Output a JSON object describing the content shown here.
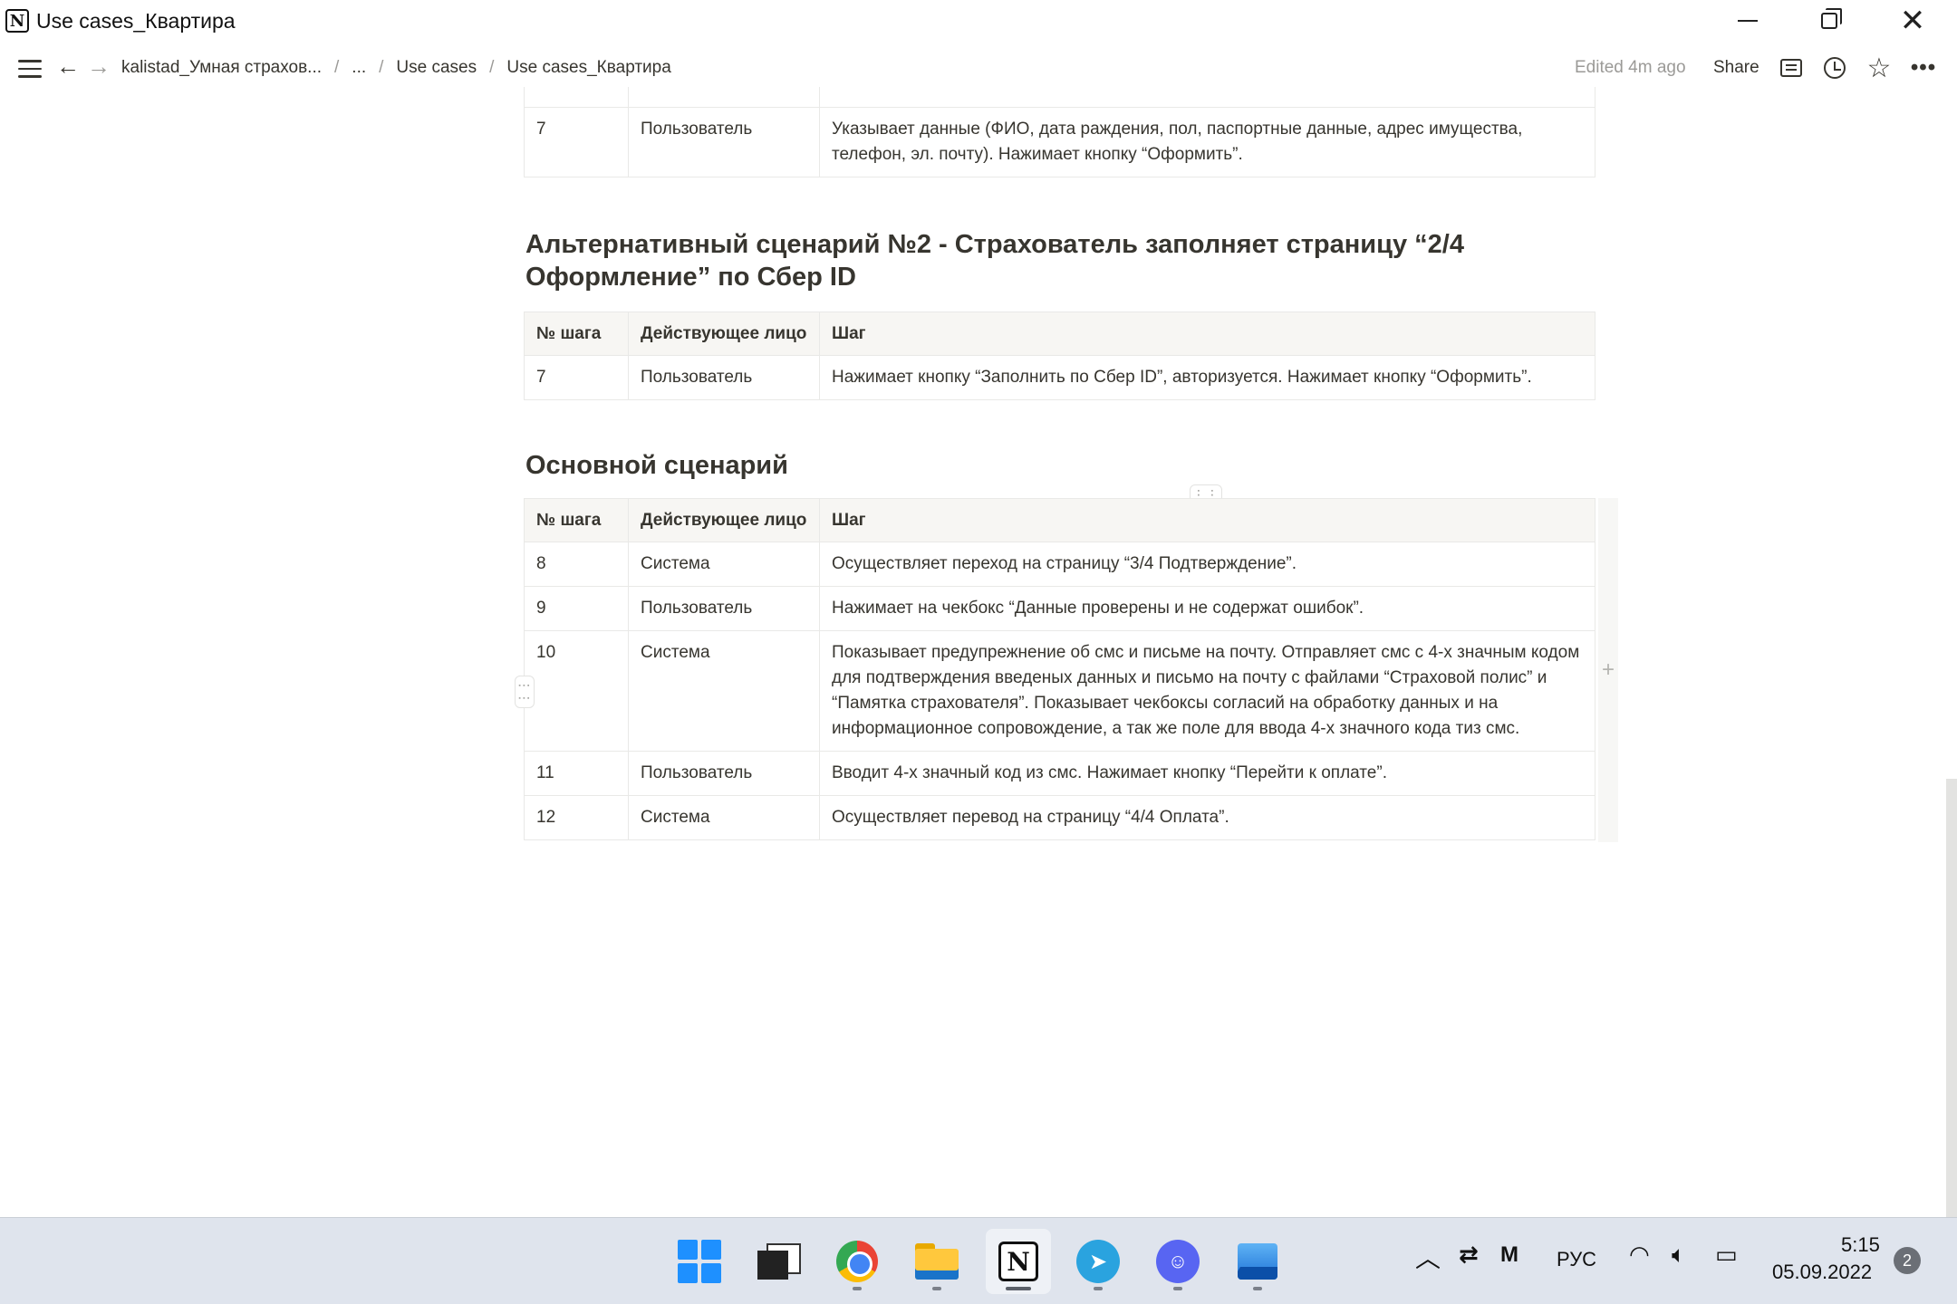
{
  "window": {
    "title": "Use cases_Квартира",
    "logo_letter": "N",
    "minimize_label": "",
    "close_glyph": "✕"
  },
  "topbar": {
    "breadcrumbs": [
      "kalistad_Умная страхов...",
      "...",
      "Use cases",
      "Use cases_Квартира"
    ],
    "edited": "Edited 4m ago",
    "share": "Share",
    "back_glyph": "←",
    "forward_glyph": "→",
    "star_glyph": "☆",
    "more_glyph": "•••"
  },
  "table_top": {
    "rows": [
      {
        "step": "7",
        "actor": "Пользователь",
        "action": "Указывает данные (ФИО, дата раждения, пол, паспортные данные, адрес имущества, телефон, эл. почту). Нажимает кнопку “Оформить”."
      }
    ]
  },
  "section_alt2": {
    "heading": "Альтернативный сценарий №2 - Страхователь заполняет страницу “2/4 Оформление” по Сбер ID",
    "headers": [
      "№ шага",
      "Действующее лицо",
      "Шаг"
    ],
    "rows": [
      {
        "step": "7",
        "actor": "Пользователь",
        "action": "Нажимает кнопку “Заполнить по Сбер ID”, авторизуется. Нажимает кнопку “Оформить”."
      }
    ]
  },
  "section_main": {
    "heading": "Основной сценарий",
    "headers": [
      "№ шага",
      "Действующее лицо",
      "Шаг"
    ],
    "rows": [
      {
        "step": "8",
        "actor": "Система",
        "action": "Осуществляет переход на страницу “3/4 Подтверждение”."
      },
      {
        "step": "9",
        "actor": "Пользователь",
        "action": "Нажимает на чекбокс “Данные проверены и не содержат ошибок”."
      },
      {
        "step": "10",
        "actor": "Система",
        "action": "Показывает предупрежнение об смс и письме на почту. Отправляет смс с 4-х значным кодом для подтверждения введеных данных и письмо на почту с файлами “Страховой полис” и “Памятка страхователя”. Показывает чекбоксы согласий на обработку данных и на информационное сопровождение, а так же поле для ввода 4-х значного кода тиз смс."
      },
      {
        "step": "11",
        "actor": "Пользователь",
        "action": "Вводит 4-х значный код из смс. Нажимает кнопку “Перейти к оплате”."
      },
      {
        "step": "12",
        "actor": "Система",
        "action": "Осуществляет перевод на страницу “4/4 Оплата”."
      }
    ]
  },
  "ui": {
    "help_glyph": "?",
    "add_column_glyph": "+",
    "drag_glyph": "⋮⋮"
  },
  "taskbar": {
    "apps": [
      "start-icon",
      "tv-icon",
      "chrome-icon",
      "file-explorer-icon",
      "notion-icon",
      "telegram-icon",
      "discord-icon",
      "photos-icon"
    ],
    "lang": "РУС",
    "time": "5:15",
    "date": "05.09.2022",
    "notifications": "2"
  }
}
